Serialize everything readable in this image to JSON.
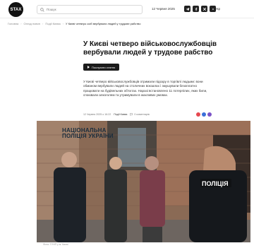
{
  "header": {
    "logo_text": "STAX",
    "search_placeholder": "Пошук",
    "date": "12 Червня 2025",
    "socials": [
      "telegram-icon",
      "facebook-icon",
      "x-icon",
      "youtube-icon"
    ],
    "lang": "Укр"
  },
  "breadcrumbs": {
    "items": [
      "Головна",
      "Огляд новин",
      "Події Києва"
    ],
    "current": "У Києві четверо осіб вербували людей у трудове рабство"
  },
  "article": {
    "title": "У Києві четверо військовослужбовців вербували людей у трудове рабство",
    "listen_label": "Послухати статтю",
    "lead": "У Києві четверо військовослужбовців отримали підозру в торгівлі людьми: вони обманом вербували людей на столичних вокзалах і змушували безоплатно працювати на будівельних об'єктах. Наразі встановлено 11 потерпілих, яких били, споювали алкоголем та утримували в жахливих умовах.",
    "meta": {
      "date": "12 Червня 2025 о 16:22",
      "category": "Події Києва",
      "comments": "0 коментарів"
    },
    "photo_overlay": [
      "НАЦІОНАЛЬНА",
      "ПОЛІЦІЯ УКРАЇНИ"
    ],
    "photo_caption": "Фото: ГУНП у м. Києві"
  },
  "colors": {
    "accent": "#111111",
    "background": "#ffffff",
    "react1": "#e6484f",
    "react2": "#3b6fd8",
    "react3": "#7b53c7"
  }
}
